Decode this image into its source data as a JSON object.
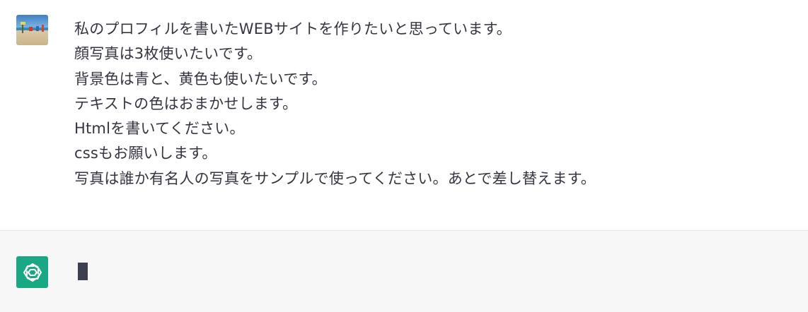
{
  "user": {
    "avatar_icon": "beach-photo-avatar",
    "message_lines": [
      "私のプロフィルを書いたWEBサイトを作りたいと思っています。",
      "顔写真は3枚使いたいです。",
      "背景色は青と、黄色も使いたいです。",
      "テキストの色はおまかせします。",
      "Htmlを書いてください。",
      "cssもお願いします。",
      "写真は誰か有名人の写真をサンプルで使ってください。あとで差し替えます。"
    ]
  },
  "assistant": {
    "avatar_icon": "openai-logo-icon",
    "avatar_color": "#19a784",
    "state": "typing-cursor"
  }
}
